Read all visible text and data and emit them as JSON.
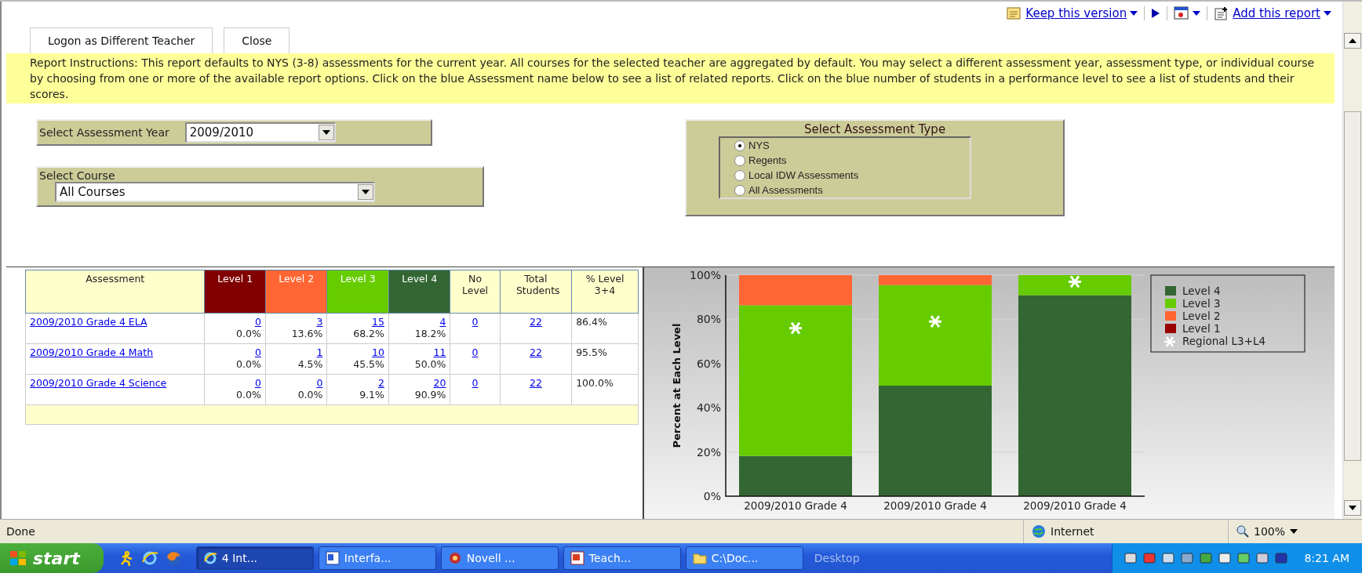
{
  "toolbar": {
    "items": [
      {
        "kind": "link",
        "label": "Keep this version"
      },
      {
        "kind": "icon"
      },
      {
        "kind": "menu"
      },
      {
        "kind": "link",
        "label": "Add this report"
      }
    ]
  },
  "buttons": [
    "Logon as Different Teacher",
    "Close"
  ],
  "instructions": "Report Instructions: This report defaults to NYS (3-8) assessments for the current year.  All courses for the selected teacher are aggregated by default.  You may select a different assessment year, assessment type, or individual course by choosing from one or more of the available report options.  Click on the blue Assessment name below to see a list of related reports.  Click on the blue number of students in a performance level to see a list of students and their scores.",
  "year_select": {
    "label": "Select Assessment Year",
    "value": "2009/2010"
  },
  "course_select": {
    "label": "Select Course",
    "value": "All Courses"
  },
  "assessment_type": {
    "title": "Select Assessment Type",
    "options": [
      {
        "label": "NYS",
        "selected": true
      },
      {
        "label": "Regents",
        "selected": false
      },
      {
        "label": "Local IDW Assessments",
        "selected": false
      },
      {
        "label": "All Assessments",
        "selected": false
      }
    ]
  },
  "table": {
    "columns": [
      {
        "label": "Assessment"
      },
      {
        "label": "Level 1",
        "color": "#800000"
      },
      {
        "label": "Level 2",
        "color": "#ff6633"
      },
      {
        "label": "Level 3",
        "color": "#66cc00"
      },
      {
        "label": "Level 4",
        "color": "#336633"
      },
      {
        "label": "No Level"
      },
      {
        "label": "Total Students"
      },
      {
        "label": "% Level 3+4"
      }
    ],
    "rows": [
      {
        "assessment": "2009/2010 Grade 4 ELA",
        "levels": [
          {
            "count": "0",
            "percent": "0.0%"
          },
          {
            "count": "3",
            "percent": "13.6%"
          },
          {
            "count": "15",
            "percent": "68.2%"
          },
          {
            "count": "4",
            "percent": "18.2%"
          }
        ],
        "no_level": "0",
        "total": "22",
        "pct_l34": "86.4%"
      },
      {
        "assessment": "2009/2010 Grade 4 Math",
        "levels": [
          {
            "count": "0",
            "percent": "0.0%"
          },
          {
            "count": "1",
            "percent": "4.5%"
          },
          {
            "count": "10",
            "percent": "45.5%"
          },
          {
            "count": "11",
            "percent": "50.0%"
          }
        ],
        "no_level": "0",
        "total": "22",
        "pct_l34": "95.5%"
      },
      {
        "assessment": "2009/2010 Grade 4 Science",
        "levels": [
          {
            "count": "0",
            "percent": "0.0%"
          },
          {
            "count": "0",
            "percent": "0.0%"
          },
          {
            "count": "2",
            "percent": "9.1%"
          },
          {
            "count": "20",
            "percent": "90.9%"
          }
        ],
        "no_level": "0",
        "total": "22",
        "pct_l34": "100.0%"
      }
    ]
  },
  "chart": {
    "chart_data": {
      "type": "bar",
      "stacked": true,
      "grid": true,
      "legend": true,
      "ylabel": "Percent at Each Level",
      "categories": [
        "2009/2010 Grade 4",
        "2009/2010 Grade 4",
        "2009/2010 Grade 4"
      ],
      "ylim": [
        0,
        100
      ],
      "yticks": [
        {
          "value": 0,
          "label": "0%"
        },
        {
          "value": 20,
          "label": "20%"
        },
        {
          "value": 40,
          "label": "40%"
        },
        {
          "value": 60,
          "label": "60%"
        },
        {
          "value": 80,
          "label": "80%"
        },
        {
          "value": 100,
          "label": "100%"
        }
      ],
      "series": [
        {
          "name": "Level 4",
          "color": "#336633",
          "values": [
            18.2,
            50.0,
            90.9
          ]
        },
        {
          "name": "Level 3",
          "color": "#66cc00",
          "values": [
            68.2,
            45.5,
            9.1
          ]
        },
        {
          "name": "Level 2",
          "color": "#ff6633",
          "values": [
            13.6,
            4.5,
            0
          ]
        },
        {
          "name": "Level 1",
          "color": "#990000",
          "values": [
            0,
            0,
            0
          ]
        },
        {
          "name": "Regional L3+L4",
          "color": "#ffffff",
          "type": "scatter",
          "values": [
            76,
            79,
            97
          ]
        }
      ]
    }
  },
  "status_bar": {
    "text": "Done",
    "zone": "Internet",
    "zoom": "100%"
  },
  "taskbar": {
    "start": "start",
    "tasks": [
      {
        "label": "4 Int...",
        "selected": true
      },
      {
        "label": "Interfa...",
        "selected": false
      },
      {
        "label": "Novell ...",
        "selected": false
      },
      {
        "label": "Teach...",
        "selected": false
      },
      {
        "label": "C:\\Doc...",
        "selected": false
      }
    ],
    "desktop": "Desktop",
    "clock": "8:21 AM"
  }
}
